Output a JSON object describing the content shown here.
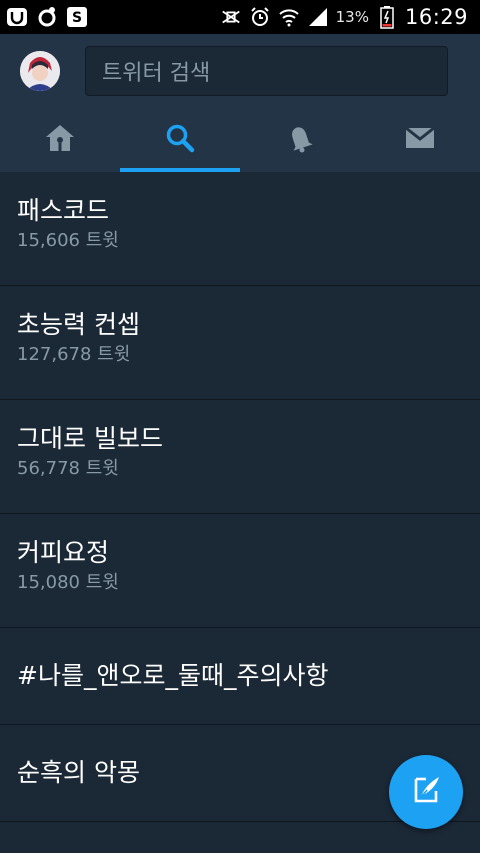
{
  "status_bar": {
    "battery_percent": "13%",
    "time": "16:29"
  },
  "header": {
    "search_placeholder": "트위터 검색",
    "tabs": [
      {
        "icon": "home-icon",
        "active": false
      },
      {
        "icon": "search-icon",
        "active": true
      },
      {
        "icon": "bell-icon",
        "active": false
      },
      {
        "icon": "envelope-icon",
        "active": false
      }
    ]
  },
  "trends": [
    {
      "title": "패스코드",
      "count": "15,606 트윗"
    },
    {
      "title": "초능력 컨셉",
      "count": "127,678 트윗"
    },
    {
      "title": "그대로 빌보드",
      "count": "56,778 트윗"
    },
    {
      "title": "커피요정",
      "count": "15,080 트윗"
    },
    {
      "title": "#나를_앤오로_둘때_주의사항"
    },
    {
      "title": "순흑의 악몽"
    }
  ],
  "colors": {
    "accent": "#1da1f2",
    "background": "#1b2836",
    "header": "#243447",
    "secondary_text": "#8899a6"
  }
}
